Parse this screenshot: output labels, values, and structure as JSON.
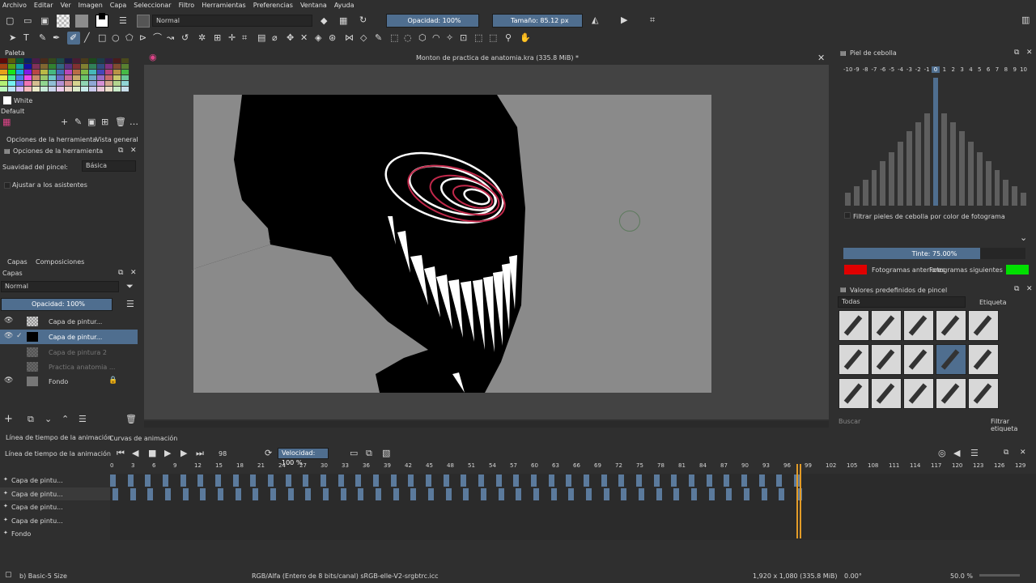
{
  "menu": [
    "Archivo",
    "Editar",
    "Ver",
    "Imagen",
    "Capa",
    "Seleccionar",
    "Filtro",
    "Herramientas",
    "Preferencias",
    "Ventana",
    "Ayuda"
  ],
  "toolbar": {
    "blend_mode": "Normal",
    "opacity_label": "Opacidad: 100%",
    "size_label": "Tamaño: 85.12 px"
  },
  "palette": {
    "title": "Paleta",
    "color_name": "White",
    "preset_name": "Default"
  },
  "tool_options": {
    "tab1": "Opciones de la herramienta",
    "tab2": "Vista general",
    "title": "Opciones de la herramienta",
    "smoothing_label": "Suavidad del pincel:",
    "smoothing_value": "Básica",
    "assistants_label": "Ajustar a los asistentes"
  },
  "layers": {
    "tab1": "Capas",
    "tab2": "Composiciones",
    "title": "Capas",
    "blend": "Normal",
    "opacity": "Opacidad:  100%",
    "items": [
      {
        "name": "Capa de pintur..."
      },
      {
        "name": "Capa de pintur..."
      },
      {
        "name": "Capa de pintura 2"
      },
      {
        "name": "Practica anatomia ..."
      },
      {
        "name": "Fondo"
      }
    ]
  },
  "document": {
    "title": "Monton de practica de anatomia.kra (335.8 MiB) *"
  },
  "onion": {
    "title": "Piel de cebolla",
    "frames": [
      "-10",
      "-9",
      "-8",
      "-7",
      "-6",
      "-5",
      "-4",
      "-3",
      "-2",
      "-1",
      "0",
      "1",
      "2",
      "3",
      "4",
      "5",
      "6",
      "7",
      "8",
      "9",
      "10"
    ],
    "levels": [
      0.1,
      0.15,
      0.2,
      0.28,
      0.35,
      0.42,
      0.5,
      0.58,
      0.65,
      0.72,
      1.0,
      0.72,
      0.65,
      0.58,
      0.5,
      0.42,
      0.35,
      0.28,
      0.2,
      0.15,
      0.1
    ],
    "filter_label": "Filtrar pieles de cebolla por color de fotograma",
    "tint_label": "Tinte: 75.00%",
    "tint": 0.75,
    "prev_label": "Fotogramas anteriores",
    "next_label": "Fotogramas siguientes",
    "prev_color": "#e00000",
    "next_color": "#00e000"
  },
  "brushes": {
    "title": "Valores predefinidos de pincel",
    "filter": "Todas",
    "tag": "Etiqueta",
    "search": "Buscar",
    "filter_tag": "Filtrar etiqueta"
  },
  "timeline": {
    "tab1": "Línea de tiempo de la animación",
    "tab2": "Curvas de animación",
    "title": "Línea de tiempo de la animación",
    "frame": "98",
    "speed": "Velocidad: 100 %",
    "ruler": [
      "0",
      "3",
      "6",
      "9",
      "12",
      "15",
      "18",
      "21",
      "24",
      "27",
      "30",
      "33",
      "36",
      "39",
      "42",
      "45",
      "48",
      "51",
      "54",
      "57",
      "60",
      "63",
      "66",
      "69",
      "72",
      "75",
      "78",
      "81",
      "84",
      "87",
      "90",
      "93",
      "96",
      "99",
      "102",
      "105",
      "108",
      "111",
      "114",
      "117",
      "120",
      "123",
      "126",
      "129"
    ],
    "rows": [
      {
        "name": "Capa de pintu..."
      },
      {
        "name": "Capa de pintu..."
      },
      {
        "name": "Capa de pintu..."
      },
      {
        "name": "Capa de pintu..."
      },
      {
        "name": "Fondo"
      }
    ]
  },
  "status": {
    "brush": "b) Basic-5 Size",
    "color_space": "RGB/Alfa (Entero de 8 bits/canal)  sRGB-elle-V2-srgbtrc.icc",
    "dims": "1,920 x 1,080 (335.8 MiB)",
    "rotation": "0.00°",
    "zoom": "50.0 %"
  }
}
